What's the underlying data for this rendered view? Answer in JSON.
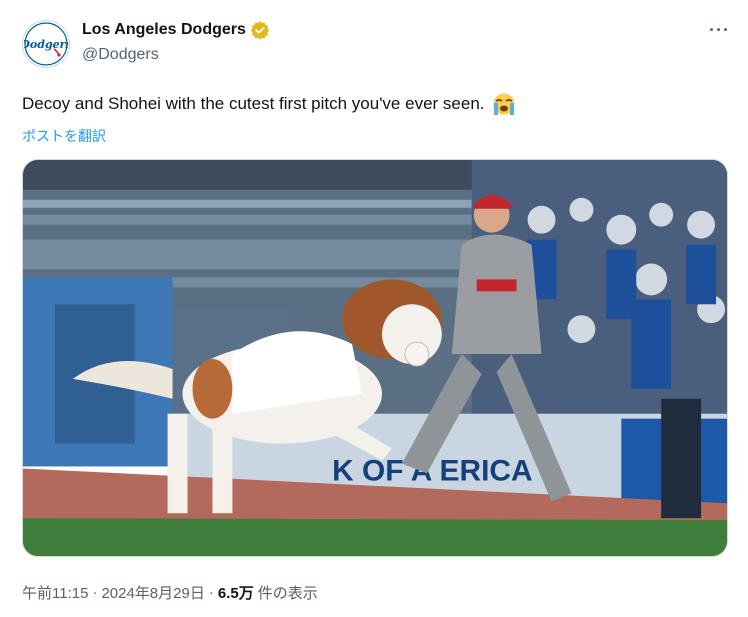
{
  "account": {
    "display_name": "Los Angeles Dodgers",
    "handle": "@Dodgers",
    "verified_icon": "gold-verified-badge-icon",
    "avatar_icon": "dodgers-logo-icon",
    "avatar_logo_text": "Dodgers"
  },
  "more_icon": "more-options-icon",
  "more_label": "···",
  "tweet": {
    "text": "Decoy and Shohei with the cutest first pitch you've ever seen.",
    "emoji_icon": "loudly-crying-face-icon",
    "translate_label": "ポストを翻訳"
  },
  "media": {
    "description_icon": "video-thumbnail-icon",
    "banner_text": "K OF A   ERICA"
  },
  "meta": {
    "time": "午前11:15",
    "separator1": "·",
    "date": "2024年8月29日",
    "separator2": "·",
    "views_count": "6.5万",
    "views_label": "件の表示"
  },
  "colors": {
    "link_blue": "#1d9bf0",
    "verified_gold": "#e2b719",
    "dodger_blue": "#005a9c",
    "secondary_text": "#536471"
  }
}
